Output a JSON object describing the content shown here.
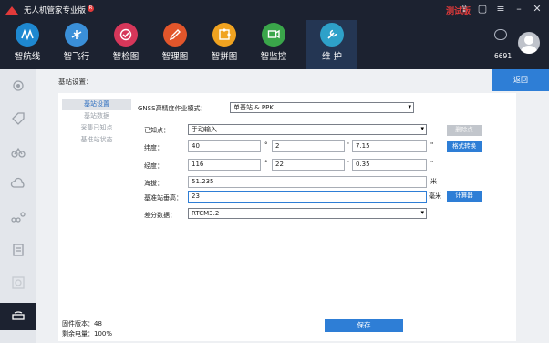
{
  "window": {
    "title": "无人机管家专业版",
    "badge": "R",
    "test_version": "测试版"
  },
  "topnav": {
    "items": [
      {
        "label": "智航线",
        "color": "#1e88d0",
        "icon": "route-icon"
      },
      {
        "label": "智飞行",
        "color": "#3a8fd8",
        "icon": "drone-icon"
      },
      {
        "label": "智检图",
        "color": "#d6375a",
        "icon": "check-icon"
      },
      {
        "label": "智理图",
        "color": "#e2562b",
        "icon": "edit-icon"
      },
      {
        "label": "智拼图",
        "color": "#f0a320",
        "icon": "puzzle-icon"
      },
      {
        "label": "智监控",
        "color": "#3aa64a",
        "icon": "monitor-icon"
      },
      {
        "label": "维 护",
        "color": "#2ea1c9",
        "icon": "wrench-icon"
      }
    ],
    "user_count": "6691"
  },
  "sidebar": {
    "icons": [
      "gimbal-icon",
      "tag-icon",
      "bike-icon",
      "cloud-icon",
      "flow-icon",
      "report-icon",
      "disc-icon",
      "basestation-icon"
    ]
  },
  "breadcrumb": "基站设置：",
  "back_label": "返回",
  "subnav": [
    "基站设置",
    "基站数据",
    "采集已知点",
    "基准站状态"
  ],
  "form": {
    "gnss_label": "GNSS高精度作业模式：",
    "gnss_value": "单基站 & PPK",
    "known_label": "已知点：",
    "known_value": "手动输入",
    "delete_point": "删除点",
    "lat_label": "纬度：",
    "lat_deg": "40",
    "lat_min": "2",
    "lat_sec": "7.15",
    "format_convert": "格式转换",
    "lon_label": "经度：",
    "lon_deg": "116",
    "lon_min": "22",
    "lon_sec": "0.35",
    "alt_label": "海拔：",
    "alt_value": "51.235",
    "alt_unit": "米",
    "height_label": "基准站垂高：",
    "height_value": "23",
    "height_unit": "毫米",
    "calculator": "计算器",
    "diff_label": "差分数据：",
    "diff_value": "RTCM3.2",
    "deg_mark": "°",
    "min_mark": "'",
    "sec_mark": "\""
  },
  "footer": {
    "firmware": "固件版本：48",
    "battery": "剩余电量：100%"
  },
  "save_label": "保存"
}
